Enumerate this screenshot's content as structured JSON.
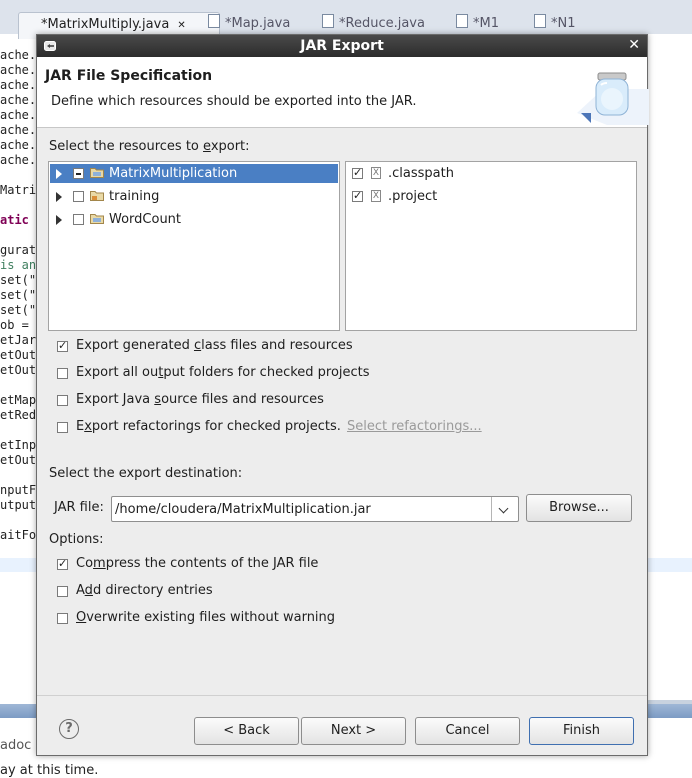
{
  "editor": {
    "tabs": [
      {
        "label": "*MatrixMultiply.java",
        "close": "✕",
        "active": true
      },
      {
        "label": "*Map.java"
      },
      {
        "label": "*Reduce.java"
      },
      {
        "label": "*M1"
      },
      {
        "label": "*N1"
      }
    ],
    "code_lines": [
      "ache.h",
      "ache.h",
      "ache.h",
      "ache.h",
      "ache.h",
      "ache.h",
      "ache.h",
      "ache.h",
      "Matrix",
      "atic v",
      "gurati",
      "is an",
      "set(\"m",
      "set(\"n",
      "set(\"p",
      "ob = J",
      "etJarB",
      "etOutp",
      "etOutp",
      "etMapp",
      "etRedu",
      "etInpu",
      "etOutp",
      "nputFo",
      "utputF",
      "aitFor"
    ],
    "bottom_text_1": "adoc",
    "bottom_text_2": "ay at this time."
  },
  "dialog": {
    "title": "JAR Export",
    "close_glyph": "✕",
    "header_title": "JAR File Specification",
    "header_desc": "Define which resources should be exported into the JAR.",
    "resources_label_pre": "Select the resources to ",
    "resources_label_mn": "e",
    "resources_label_post": "xport:",
    "tree": [
      {
        "label": "MatrixMultiplication",
        "state": "partial",
        "selected": true
      },
      {
        "label": "training",
        "state": "unchecked",
        "selected": false
      },
      {
        "label": "WordCount",
        "state": "unchecked",
        "selected": false
      }
    ],
    "files": [
      {
        "label": ".classpath",
        "checked": true,
        "icon": "x-file-icon"
      },
      {
        "label": ".project",
        "checked": true,
        "icon": "x-file-icon"
      }
    ],
    "export_options": [
      {
        "pre": "Export generated ",
        "mn": "c",
        "post": "lass files and resources",
        "checked": true
      },
      {
        "pre": "Export all ou",
        "mn": "t",
        "post": "put folders for checked projects",
        "checked": false
      },
      {
        "pre": "Export Java ",
        "mn": "s",
        "post": "ource files and resources",
        "checked": false
      },
      {
        "pre": "E",
        "mn": "x",
        "post": "port refactorings for checked projects.",
        "checked": false
      }
    ],
    "select_refactorings_link": "Select refactorings...",
    "destination_label": "Select the export destination:",
    "jar_file_label": "JAR file:",
    "jar_file_value": "/home/cloudera/MatrixMultiplication.jar",
    "browse_button": "Browse...",
    "options_label": "Options:",
    "options": [
      {
        "pre": "Co",
        "mn": "m",
        "post": "press the contents of the JAR file",
        "checked": true
      },
      {
        "pre": "A",
        "mn": "d",
        "post": "d directory entries",
        "checked": false
      },
      {
        "pre": "",
        "mn": "O",
        "post": "verwrite existing files without warning",
        "checked": false
      }
    ],
    "help_glyph": "?",
    "buttons": {
      "back": "< Back",
      "next": "Next >",
      "cancel": "Cancel",
      "finish": "Finish"
    }
  }
}
